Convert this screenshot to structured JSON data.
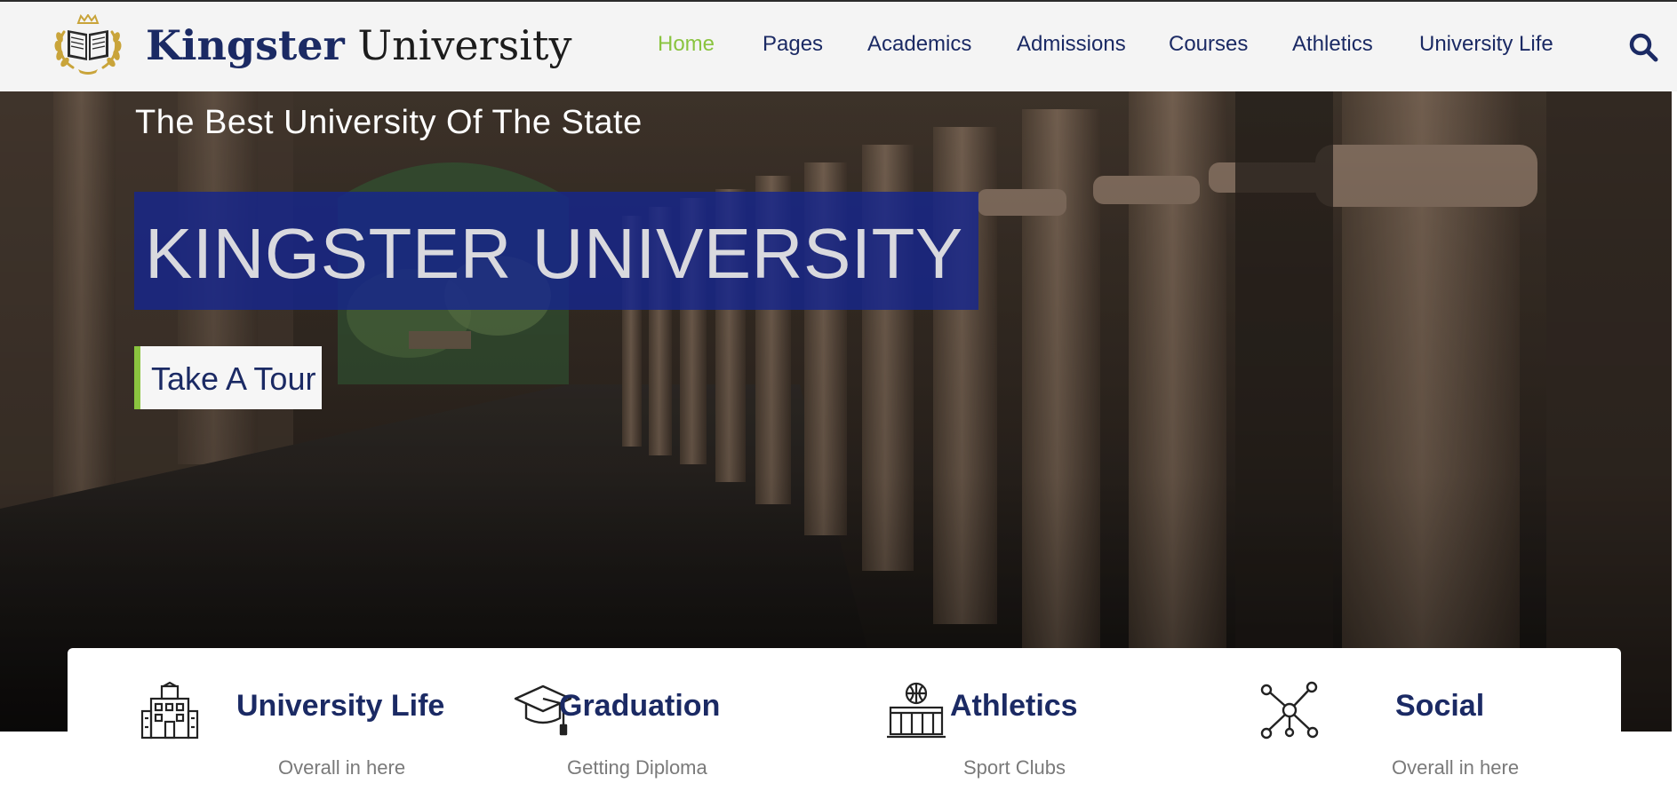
{
  "brand": {
    "name_bold": "Kingster",
    "name_light": "University",
    "emblem_icon": "book-laurel-crown-icon"
  },
  "nav": {
    "items": [
      {
        "label": "Home",
        "active": true
      },
      {
        "label": "Pages",
        "active": false
      },
      {
        "label": "Academics",
        "active": false
      },
      {
        "label": "Admissions",
        "active": false
      },
      {
        "label": "Courses",
        "active": false
      },
      {
        "label": "Athletics",
        "active": false
      },
      {
        "label": "University Life",
        "active": false
      }
    ],
    "search_icon": "search-icon"
  },
  "hero": {
    "subtitle": "The Best University Of The State",
    "title": "KINGSTER UNIVERSITY",
    "cta_label": "Take A Tour"
  },
  "features": [
    {
      "icon": "campus-building-icon",
      "title": "University Life",
      "desc": "Overall in here"
    },
    {
      "icon": "graduation-cap-icon",
      "title": "Graduation",
      "desc": "Getting Diploma"
    },
    {
      "icon": "sports-arena-icon",
      "title": "Athletics",
      "desc": "Sport Clubs"
    },
    {
      "icon": "network-icon",
      "title": "Social",
      "desc": "Overall in here"
    }
  ],
  "colors": {
    "brand_navy": "#1b2a64",
    "accent_green": "#8ac43f",
    "title_box_blue": "#16268c",
    "header_bg": "#f4f4f4",
    "logo_gold": "#c9a43a"
  }
}
